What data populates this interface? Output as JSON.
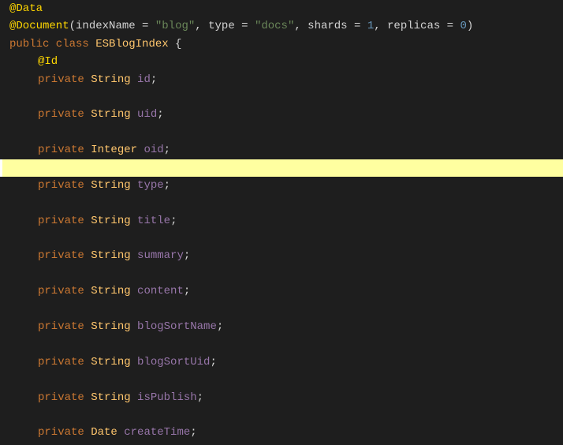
{
  "editor": {
    "background": "#1e1e1e",
    "lines": [
      {
        "id": "line1",
        "indent": "none",
        "highlighted": false,
        "cursor": false,
        "parts": [
          {
            "type": "annotation",
            "text": "@Data"
          }
        ]
      },
      {
        "id": "line2",
        "indent": "none",
        "highlighted": false,
        "cursor": false,
        "parts": [
          {
            "type": "annotation",
            "text": "@Document"
          },
          {
            "type": "plain",
            "text": "("
          },
          {
            "type": "plain",
            "text": "indexName"
          },
          {
            "type": "plain",
            "text": " = "
          },
          {
            "type": "string-val",
            "text": "\"blog\""
          },
          {
            "type": "plain",
            "text": ", "
          },
          {
            "type": "plain",
            "text": "type"
          },
          {
            "type": "plain",
            "text": " = "
          },
          {
            "type": "string-val",
            "text": "\"docs\""
          },
          {
            "type": "plain",
            "text": ", "
          },
          {
            "type": "plain",
            "text": "shards"
          },
          {
            "type": "plain",
            "text": " = "
          },
          {
            "type": "number-val",
            "text": "1"
          },
          {
            "type": "plain",
            "text": ", "
          },
          {
            "type": "plain",
            "text": "replicas"
          },
          {
            "type": "plain",
            "text": " = "
          },
          {
            "type": "number-val",
            "text": "0"
          },
          {
            "type": "plain",
            "text": ")"
          }
        ]
      },
      {
        "id": "line3",
        "indent": "none",
        "highlighted": false,
        "cursor": false,
        "parts": [
          {
            "type": "keyword",
            "text": "public class"
          },
          {
            "type": "plain",
            "text": " "
          },
          {
            "type": "class-name",
            "text": "ESBlogIndex"
          },
          {
            "type": "plain",
            "text": " {"
          }
        ]
      },
      {
        "id": "line4",
        "indent": "inner",
        "highlighted": false,
        "cursor": false,
        "parts": [
          {
            "type": "annotation",
            "text": "@Id"
          }
        ]
      },
      {
        "id": "line5",
        "indent": "inner",
        "highlighted": false,
        "cursor": false,
        "parts": [
          {
            "type": "keyword",
            "text": "private"
          },
          {
            "type": "plain",
            "text": " "
          },
          {
            "type": "type-name",
            "text": "String"
          },
          {
            "type": "plain",
            "text": " "
          },
          {
            "type": "field-name",
            "text": "id"
          },
          {
            "type": "plain",
            "text": ";"
          }
        ]
      },
      {
        "id": "line6",
        "indent": "inner",
        "highlighted": false,
        "cursor": false,
        "parts": []
      },
      {
        "id": "line7",
        "indent": "inner",
        "highlighted": false,
        "cursor": false,
        "parts": [
          {
            "type": "keyword",
            "text": "private"
          },
          {
            "type": "plain",
            "text": " "
          },
          {
            "type": "type-name",
            "text": "String"
          },
          {
            "type": "plain",
            "text": " "
          },
          {
            "type": "field-name",
            "text": "uid"
          },
          {
            "type": "plain",
            "text": ";"
          }
        ]
      },
      {
        "id": "line8",
        "indent": "inner",
        "highlighted": false,
        "cursor": false,
        "parts": []
      },
      {
        "id": "line9",
        "indent": "inner",
        "highlighted": false,
        "cursor": false,
        "parts": [
          {
            "type": "keyword",
            "text": "private"
          },
          {
            "type": "plain",
            "text": " "
          },
          {
            "type": "type-name",
            "text": "Integer"
          },
          {
            "type": "plain",
            "text": " "
          },
          {
            "type": "field-name",
            "text": "oid"
          },
          {
            "type": "plain",
            "text": ";"
          }
        ]
      },
      {
        "id": "line10",
        "indent": "inner",
        "highlighted": true,
        "cursor": true,
        "parts": []
      },
      {
        "id": "line11",
        "indent": "inner",
        "highlighted": false,
        "cursor": false,
        "parts": [
          {
            "type": "keyword",
            "text": "private"
          },
          {
            "type": "plain",
            "text": " "
          },
          {
            "type": "type-name",
            "text": "String"
          },
          {
            "type": "plain",
            "text": " "
          },
          {
            "type": "field-name",
            "text": "type"
          },
          {
            "type": "plain",
            "text": ";"
          }
        ]
      },
      {
        "id": "line12",
        "indent": "inner",
        "highlighted": false,
        "cursor": false,
        "parts": []
      },
      {
        "id": "line13",
        "indent": "inner",
        "highlighted": false,
        "cursor": false,
        "parts": [
          {
            "type": "keyword",
            "text": "private"
          },
          {
            "type": "plain",
            "text": " "
          },
          {
            "type": "type-name",
            "text": "String"
          },
          {
            "type": "plain",
            "text": " "
          },
          {
            "type": "field-name",
            "text": "title"
          },
          {
            "type": "plain",
            "text": ";"
          }
        ]
      },
      {
        "id": "line14",
        "indent": "inner",
        "highlighted": false,
        "cursor": false,
        "parts": []
      },
      {
        "id": "line15",
        "indent": "inner",
        "highlighted": false,
        "cursor": false,
        "parts": [
          {
            "type": "keyword",
            "text": "private"
          },
          {
            "type": "plain",
            "text": " "
          },
          {
            "type": "type-name",
            "text": "String"
          },
          {
            "type": "plain",
            "text": " "
          },
          {
            "type": "field-name",
            "text": "summary"
          },
          {
            "type": "plain",
            "text": ";"
          }
        ]
      },
      {
        "id": "line16",
        "indent": "inner",
        "highlighted": false,
        "cursor": false,
        "parts": []
      },
      {
        "id": "line17",
        "indent": "inner",
        "highlighted": false,
        "cursor": false,
        "parts": [
          {
            "type": "keyword",
            "text": "private"
          },
          {
            "type": "plain",
            "text": " "
          },
          {
            "type": "type-name",
            "text": "String"
          },
          {
            "type": "plain",
            "text": " "
          },
          {
            "type": "field-name",
            "text": "content"
          },
          {
            "type": "plain",
            "text": ";"
          }
        ]
      },
      {
        "id": "line18",
        "indent": "inner",
        "highlighted": false,
        "cursor": false,
        "parts": []
      },
      {
        "id": "line19",
        "indent": "inner",
        "highlighted": false,
        "cursor": false,
        "parts": [
          {
            "type": "keyword",
            "text": "private"
          },
          {
            "type": "plain",
            "text": " "
          },
          {
            "type": "type-name",
            "text": "String"
          },
          {
            "type": "plain",
            "text": " "
          },
          {
            "type": "field-name",
            "text": "blogSortName"
          },
          {
            "type": "plain",
            "text": ";"
          }
        ]
      },
      {
        "id": "line20",
        "indent": "inner",
        "highlighted": false,
        "cursor": false,
        "parts": []
      },
      {
        "id": "line21",
        "indent": "inner",
        "highlighted": false,
        "cursor": false,
        "parts": [
          {
            "type": "keyword",
            "text": "private"
          },
          {
            "type": "plain",
            "text": " "
          },
          {
            "type": "type-name",
            "text": "String"
          },
          {
            "type": "plain",
            "text": " "
          },
          {
            "type": "field-name",
            "text": "blogSortUid"
          },
          {
            "type": "plain",
            "text": ";"
          }
        ]
      },
      {
        "id": "line22",
        "indent": "inner",
        "highlighted": false,
        "cursor": false,
        "parts": []
      },
      {
        "id": "line23",
        "indent": "inner",
        "highlighted": false,
        "cursor": false,
        "parts": [
          {
            "type": "keyword",
            "text": "private"
          },
          {
            "type": "plain",
            "text": " "
          },
          {
            "type": "type-name",
            "text": "String"
          },
          {
            "type": "plain",
            "text": " "
          },
          {
            "type": "field-name",
            "text": "isPublish"
          },
          {
            "type": "plain",
            "text": ";"
          }
        ]
      },
      {
        "id": "line24",
        "indent": "inner",
        "highlighted": false,
        "cursor": false,
        "parts": []
      },
      {
        "id": "line25",
        "indent": "inner",
        "highlighted": false,
        "cursor": false,
        "parts": [
          {
            "type": "keyword",
            "text": "private"
          },
          {
            "type": "plain",
            "text": " "
          },
          {
            "type": "type-name",
            "text": "Date"
          },
          {
            "type": "plain",
            "text": " "
          },
          {
            "type": "field-name",
            "text": "createTime"
          },
          {
            "type": "plain",
            "text": ";"
          }
        ]
      }
    ]
  }
}
